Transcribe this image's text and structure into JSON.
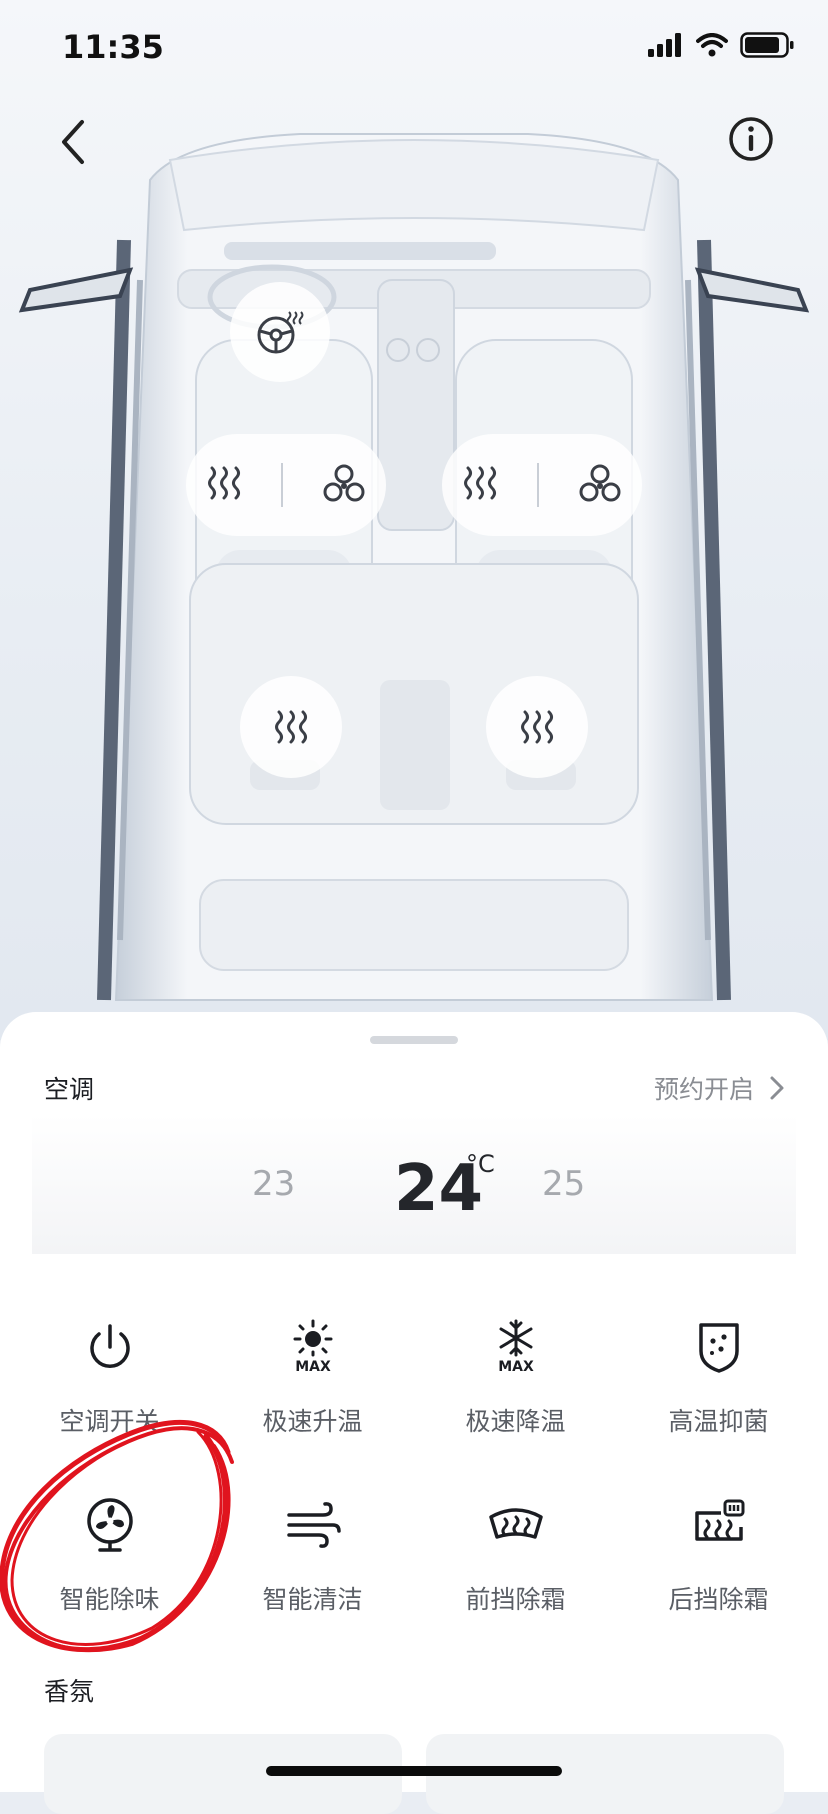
{
  "status": {
    "time": "11:35"
  },
  "nav": {
    "back_icon": "chevron-left-icon",
    "info_icon": "info-icon"
  },
  "car_controls": {
    "steering_heat_icon": "steering-wheel-heat-icon",
    "front_left": {
      "heat_icon": "seat-heat-icon",
      "vent_icon": "seat-vent-icon"
    },
    "front_right": {
      "heat_icon": "seat-heat-icon",
      "vent_icon": "seat-vent-icon"
    },
    "rear_left": {
      "heat_icon": "seat-heat-icon"
    },
    "rear_right": {
      "heat_icon": "seat-heat-icon"
    }
  },
  "climate": {
    "section_title": "空调",
    "schedule_label": "预约开启",
    "temp_prev": "23",
    "temp_current": "24",
    "temp_unit": "°C",
    "temp_next": "25",
    "functions": [
      {
        "label": "空调开关",
        "icon": "power-icon"
      },
      {
        "label": "极速升温",
        "icon": "sun-max-icon"
      },
      {
        "label": "极速降温",
        "icon": "snowflake-max-icon"
      },
      {
        "label": "高温抑菌",
        "icon": "shield-sterilize-icon"
      },
      {
        "label": "智能除味",
        "icon": "fan-icon"
      },
      {
        "label": "智能清洁",
        "icon": "wind-icon"
      },
      {
        "label": "前挡除霜",
        "icon": "front-defrost-icon"
      },
      {
        "label": "后挡除霜",
        "icon": "rear-defrost-icon"
      }
    ]
  },
  "fragrance": {
    "section_title": "香氛"
  },
  "colors": {
    "annotation": "#e0141e",
    "accent_text": "#5a5e65"
  }
}
